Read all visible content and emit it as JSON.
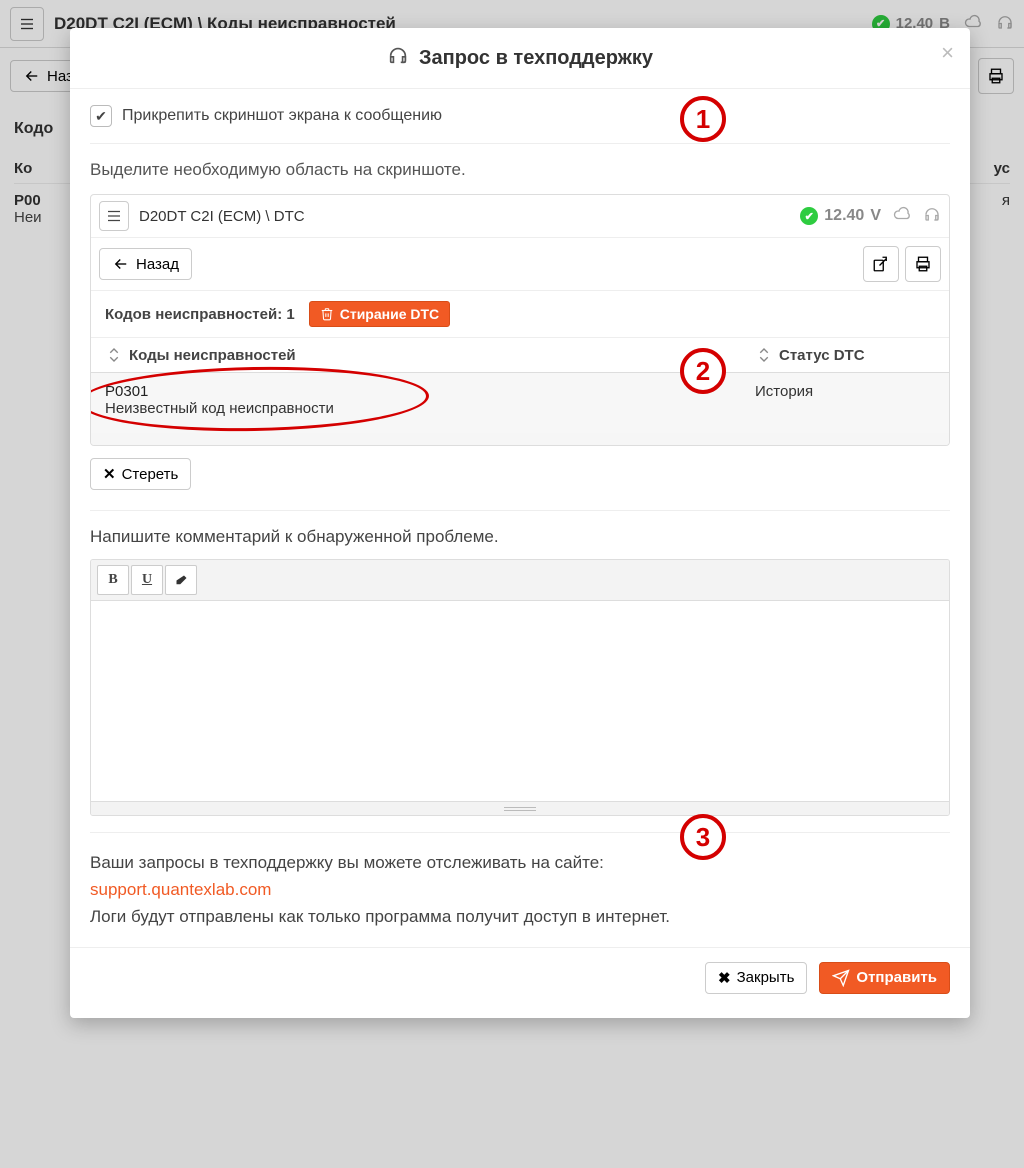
{
  "bg": {
    "crumb": "D20DT C2I (ECM) \\ Коды неисправностей",
    "voltage": "12.40",
    "voltage_unit": "В",
    "back_label": "Назад",
    "section": "Кодо",
    "th_codes_prefix": "Ко",
    "th_status_suffix": "ус",
    "row_code": "P00",
    "row_desc": "Неи",
    "row_status_suffix": "я"
  },
  "modal": {
    "title": "Запрос в техподдержку",
    "attach_label": "Прикрепить скриншот экрана к сообщению",
    "select_hint": "Выделите необходимую область на скриншоте.",
    "erase_label": "Стереть",
    "comment_label": "Напишите комментарий к обнаруженной проблеме.",
    "track_text": "Ваши запросы в техподдержку вы можете отслеживать на сайте:",
    "track_link": "support.quantexlab.com",
    "logs_text": "Логи будут отправлены как только программа получит доступ в интернет.",
    "close_label": "Закрыть",
    "send_label": "Отправить"
  },
  "badges": {
    "n1": "1",
    "n2": "2",
    "n3": "3"
  },
  "shot": {
    "crumb": "D20DT C2I (ECM) \\ DTC",
    "voltage": "12.40",
    "voltage_unit": "V",
    "back_label": "Назад",
    "dtc_count_label": "Кодов неисправностей: 1",
    "erase_dtc_label": "Стирание DTC",
    "th_codes": "Коды неисправностей",
    "th_status": "Статус DTC",
    "row": {
      "code": "P0301",
      "desc": "Неизвестный код неисправности",
      "status": "История"
    }
  }
}
